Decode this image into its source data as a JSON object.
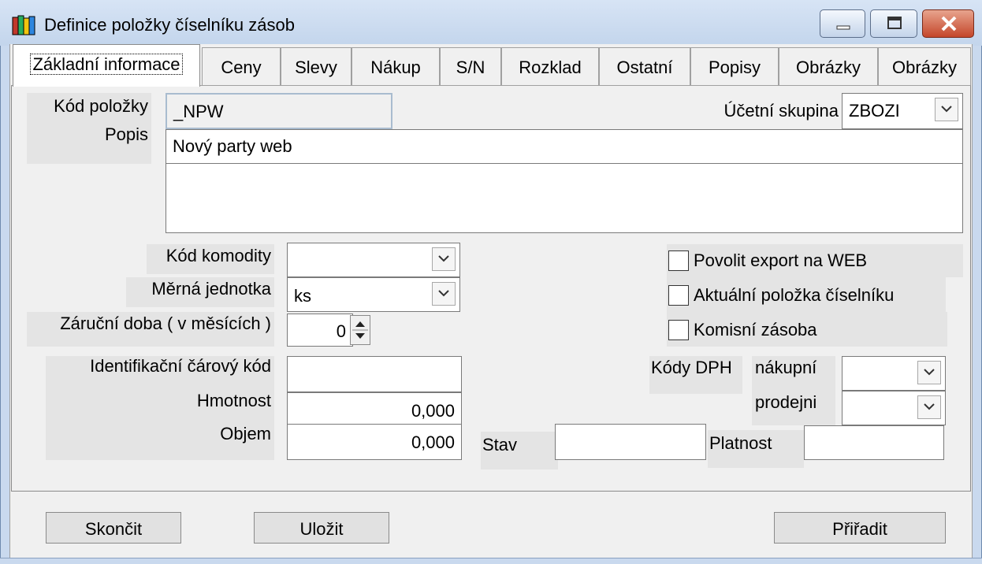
{
  "window": {
    "title": "Definice položky číselníku zásob",
    "icon": "books-app-icon"
  },
  "tabs": [
    {
      "label": "Základní informace",
      "active": true
    },
    {
      "label": "Ceny"
    },
    {
      "label": "Slevy"
    },
    {
      "label": "Nákup"
    },
    {
      "label": "S/N"
    },
    {
      "label": "Rozklad"
    },
    {
      "label": "Ostatní"
    },
    {
      "label": "Popisy"
    },
    {
      "label": "Obrázky"
    },
    {
      "label": "Obrázky"
    }
  ],
  "form": {
    "kod_polozky": {
      "label": "Kód položky",
      "value": "_NPW"
    },
    "ucetni_skupina": {
      "label": "Účetní skupina",
      "value": "ZBOZI"
    },
    "popis": {
      "label": "Popis",
      "value": "Nový party web"
    },
    "kod_komodity": {
      "label": "Kód komodity",
      "value": ""
    },
    "merna_jednotka": {
      "label": "Měrná jednotka",
      "value": "ks"
    },
    "zarucni_doba": {
      "label": "Záruční doba ( v měsících )",
      "value": "0"
    },
    "identifikacni_kod": {
      "label": "Identifikační čárový kód",
      "value": ""
    },
    "hmotnost": {
      "label": "Hmotnost",
      "value": "0,000"
    },
    "objem": {
      "label": "Objem",
      "value": "0,000"
    },
    "stav": {
      "label": "Stav",
      "value": ""
    },
    "platnost": {
      "label": "Platnost",
      "value": ""
    },
    "kody_dph": {
      "label": "Kódy DPH",
      "nakupni_label": "nákupní",
      "prodejni_label": "prodejni",
      "nakupni": "",
      "prodejni": ""
    },
    "checkboxes": [
      {
        "label": "Povolit export na WEB",
        "checked": false
      },
      {
        "label": "Aktuální položka číselníku",
        "checked": false
      },
      {
        "label": "Komisní zásoba",
        "checked": false
      }
    ]
  },
  "buttons": {
    "skoncit": "Skončit",
    "ulozit": "Uložit",
    "priradit": "Přiřadit"
  }
}
